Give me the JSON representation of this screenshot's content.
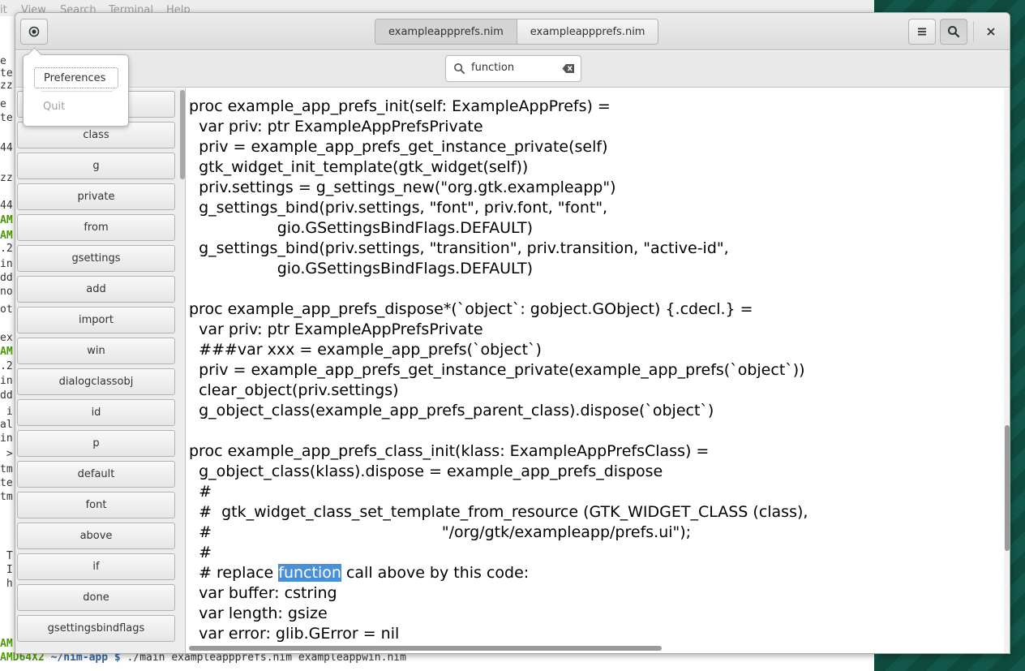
{
  "terminal": {
    "menu": [
      "it",
      "View",
      "Search",
      "Terminal",
      "Help"
    ],
    "lines": [
      {
        "t": "e",
        "c": "#333"
      },
      {
        "t": "te",
        "c": "#333"
      },
      {
        "t": "zz",
        "c": "#333"
      },
      {
        "t": "e",
        "c": "#333"
      },
      {
        "t": "te",
        "c": "#333"
      },
      {
        "t": "44",
        "c": "#333"
      },
      {
        "t": "zz",
        "c": "#333"
      },
      {
        "t": "44",
        "c": "#333"
      },
      {
        "t": "AM",
        "c": "#4e9a06"
      },
      {
        "t": "AM",
        "c": "#4e9a06"
      },
      {
        "t": ".2",
        "c": "#333"
      },
      {
        "t": "in",
        "c": "#333"
      },
      {
        "t": "dd",
        "c": "#333"
      },
      {
        "t": "no",
        "c": "#333"
      },
      {
        "t": "ot",
        "c": "#333"
      },
      {
        "t": "ex",
        "c": "#333"
      },
      {
        "t": "AM",
        "c": "#4e9a06"
      },
      {
        "t": ".2",
        "c": "#333"
      },
      {
        "t": "in",
        "c": "#333"
      },
      {
        "t": "dd",
        "c": "#333"
      },
      {
        "t": " i",
        "c": "#333"
      },
      {
        "t": "al",
        "c": "#333"
      },
      {
        "t": "in",
        "c": "#333"
      },
      {
        "t": " >",
        "c": "#333"
      },
      {
        "t": "tm",
        "c": "#333"
      },
      {
        "t": "te",
        "c": "#333"
      },
      {
        "t": "tm",
        "c": "#333"
      },
      {
        "t": " T",
        "c": "#333"
      },
      {
        "t": " I",
        "c": "#333"
      },
      {
        "t": " h",
        "c": "#333"
      },
      {
        "t": "AM",
        "c": "#4e9a06"
      }
    ],
    "prompt_host": "AMD64X2",
    "prompt_dir": " ~/nim-app $ ",
    "prompt_cmd": "./main exampleappprefs.nim exampleappwin.nim"
  },
  "window": {
    "tabs": [
      {
        "label": "exampleappprefs.nim",
        "active": true
      },
      {
        "label": "exampleappprefs.nim",
        "active": false
      }
    ],
    "search": {
      "value": "function",
      "placeholder": ""
    },
    "popover": {
      "preferences_label": "Preferences",
      "quit_label": "Quit"
    },
    "sidebar_words": [
      "class",
      "g",
      "private",
      "from",
      "gsettings",
      "add",
      "import",
      "win",
      "dialogclassobj",
      "id",
      "p",
      "default",
      "font",
      "above",
      "if",
      "done",
      "gsettingsbindflags"
    ],
    "code_lines": [
      "proc example_app_prefs_init(self: ExampleAppPrefs) =",
      "  var priv: ptr ExampleAppPrefsPrivate",
      "  priv = example_app_prefs_get_instance_private(self)",
      "  gtk_widget_init_template(gtk_widget(self))",
      "  priv.settings = g_settings_new(\"org.gtk.exampleapp\")",
      "  g_settings_bind(priv.settings, \"font\", priv.font, \"font\",",
      "                  gio.GSettingsBindFlags.DEFAULT)",
      "  g_settings_bind(priv.settings, \"transition\", priv.transition, \"active-id\",",
      "                  gio.GSettingsBindFlags.DEFAULT)",
      "",
      "proc example_app_prefs_dispose*(`object`: gobject.GObject) {.cdecl.} =",
      "  var priv: ptr ExampleAppPrefsPrivate",
      "  ###var xxx = example_app_prefs(`object`)",
      "  priv = example_app_prefs_get_instance_private(example_app_prefs(`object`))",
      "  clear_object(priv.settings)",
      "  g_object_class(example_app_prefs_parent_class).dispose(`object`)",
      "",
      "proc example_app_prefs_class_init(klass: ExampleAppPrefsClass) =",
      "  g_object_class(klass).dispose = example_app_prefs_dispose",
      "  #",
      "  #  gtk_widget_class_set_template_from_resource (GTK_WIDGET_CLASS (class),",
      "  #                                               \"/org/gtk/exampleapp/prefs.ui\");",
      "  #",
      "  # replace ",
      "  var buffer: cstring",
      "  var length: gsize",
      "  var error: glib.GError = nil"
    ],
    "highlight_line": {
      "before": "  # replace ",
      "match": "function",
      "after": " call above by this code:"
    },
    "accent_color": "#4a90d9"
  }
}
